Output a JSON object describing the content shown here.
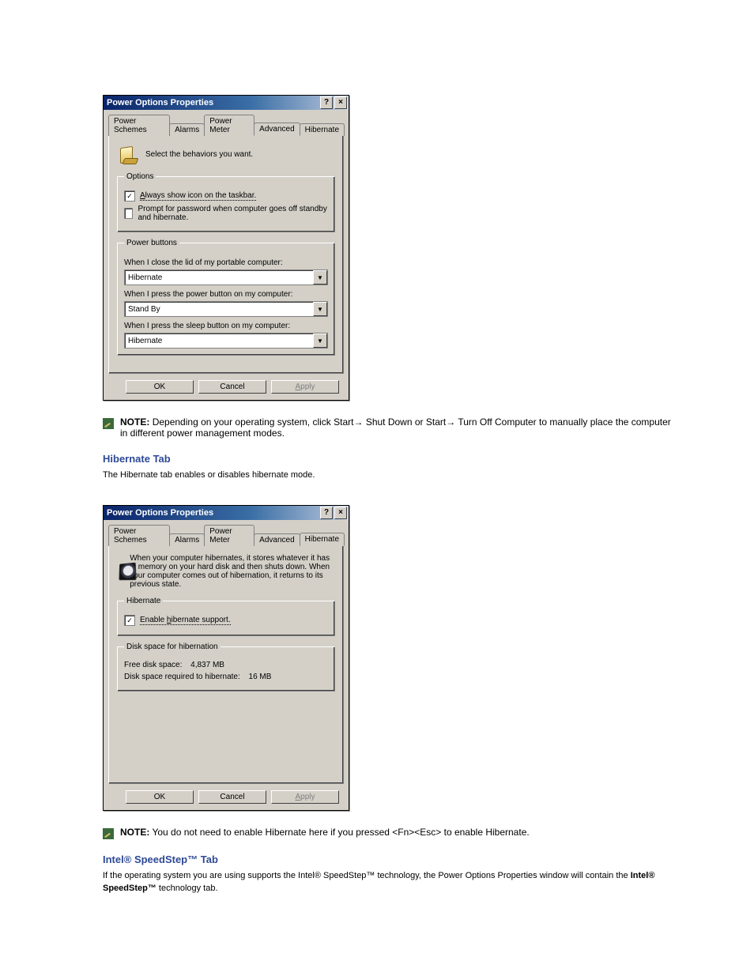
{
  "advanced": {
    "title": "Power Options Properties",
    "tabs": [
      "Power Schemes",
      "Alarms",
      "Power Meter",
      "Advanced",
      "Hibernate"
    ],
    "active_tab": "Advanced",
    "hint": "Select the behaviors you want.",
    "options_legend": "Options",
    "opt_show_icon": "Always show icon on the taskbar.",
    "opt_show_icon_checked": "✓",
    "opt_prompt_pw": "Prompt for password when computer goes off standby and hibernate.",
    "opt_prompt_pw_checked": "",
    "power_buttons_legend": "Power buttons",
    "lid_label": "When I close the lid of my portable computer:",
    "lid_value": "Hibernate",
    "power_label": "When I press the power button on my computer:",
    "power_value": "Stand By",
    "sleep_label": "When I press the sleep button on my computer:",
    "sleep_value": "Hibernate",
    "ok": "OK",
    "cancel": "Cancel",
    "apply": "Apply"
  },
  "note1": {
    "prefix": "NOTE:",
    "text": "Depending on your operating system, click Start→ Shut Down or Start→ Turn Off Computer to manually place the computer in different power management modes."
  },
  "heading_hibernate": "Hibernate Tab",
  "para_hibernate": "The Hibernate tab enables or disables hibernate mode.",
  "hibernate": {
    "title": "Power Options Properties",
    "tabs": [
      "Power Schemes",
      "Alarms",
      "Power Meter",
      "Advanced",
      "Hibernate"
    ],
    "active_tab": "Hibernate",
    "hint": "When your computer hibernates, it stores whatever it has in memory on your hard disk and then shuts down. When your computer comes out of hibernation, it returns to its previous state.",
    "hibernate_legend": "Hibernate",
    "enable_label": "Enable hibernate support.",
    "enable_checked": "✓",
    "disk_legend": "Disk space for hibernation",
    "free_label": "Free disk space:",
    "free_value": "4,837 MB",
    "required_label": "Disk space required to hibernate:",
    "required_value": "16 MB",
    "ok": "OK",
    "cancel": "Cancel",
    "apply": "Apply"
  },
  "note2": {
    "prefix": "NOTE:",
    "text": "You do not need to enable Hibernate here if you pressed <Fn><Esc> to enable Hibernate."
  },
  "speedstep": {
    "heading_prefix": "Intel",
    "heading_suffix": " SpeedStep™ Tab",
    "para_before": "If the operating system you are using supports the Intel",
    "para_mid": " SpeedStep™ technology, the Power Options Properties window will contain the ",
    "para_bold": "Intel",
    "para_bold2": " SpeedStep™",
    "para_after": " technology tab."
  },
  "reg": "®"
}
